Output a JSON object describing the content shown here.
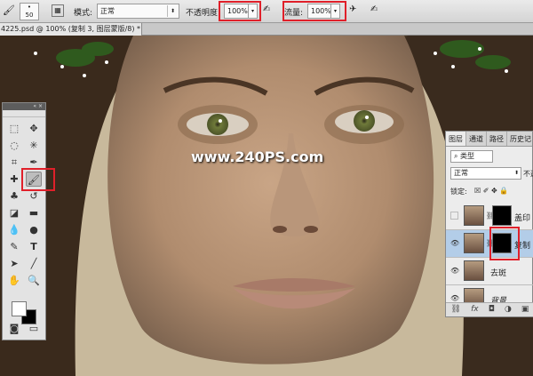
{
  "options_bar": {
    "brush_size": "50",
    "mode_label": "模式:",
    "mode_value": "正常",
    "opacity_label": "不透明度",
    "opacity_value": "100%",
    "flow_label": "流量:",
    "flow_value": "100%"
  },
  "document": {
    "tab_title": "4225.psd @ 100% (复制 3, 图层蒙版/8) *"
  },
  "watermark": "www.240PS.com",
  "layers_panel": {
    "tabs": [
      "图层",
      "通道",
      "路径",
      "历史记"
    ],
    "filter_value": "类型",
    "blend_value": "正常",
    "opacity_short": "不透",
    "lock_label": "锁定:",
    "lock_icons": "☒ ✐ ✥ 🔒",
    "layers": [
      {
        "name": "盖印",
        "visible": false,
        "has_mask": true
      },
      {
        "name": "复制",
        "visible": true,
        "has_mask": true,
        "selected": true
      },
      {
        "name": "去斑",
        "visible": true,
        "has_mask": false
      },
      {
        "name": "背景",
        "visible": true,
        "has_mask": false
      }
    ]
  }
}
